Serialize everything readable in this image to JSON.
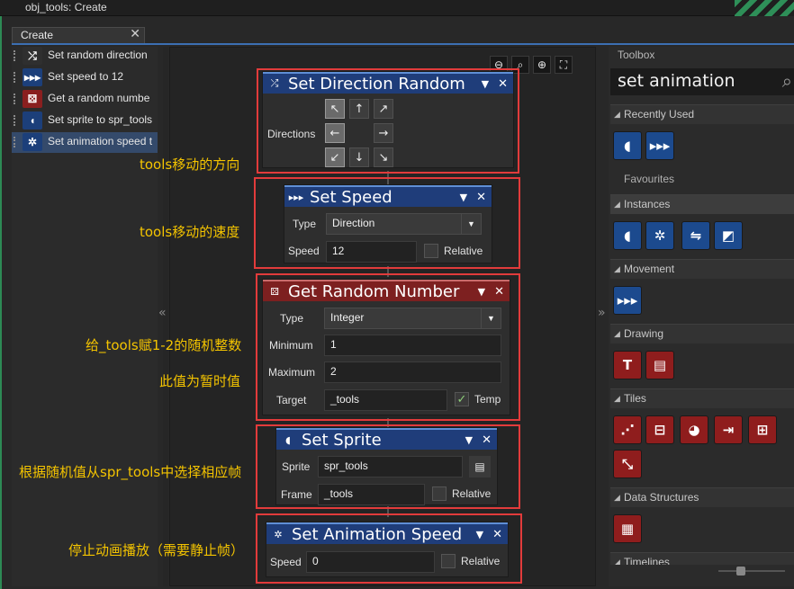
{
  "window": {
    "title": "obj_tools: Create"
  },
  "tab": {
    "label": "Create",
    "close": "✕"
  },
  "action_list": [
    {
      "label": "Set random direction",
      "icon": "random-direction-icon",
      "color": "#2f2f2f"
    },
    {
      "label": "Set speed to 12",
      "icon": "speed-icon",
      "color": "#1c3f7a"
    },
    {
      "label": "Get a random numbe",
      "icon": "dice-icon",
      "color": "#8a1f1f"
    },
    {
      "label": "Set sprite to spr_tools",
      "icon": "pacman-icon",
      "color": "#1c3f7a"
    },
    {
      "label": "Set animation speed t",
      "icon": "running-figure-icon",
      "color": "#1c3f7a"
    }
  ],
  "blocks": {
    "direction": {
      "title": "Set Direction Random",
      "label": "Directions",
      "active": [
        "nw",
        "w",
        "sw"
      ]
    },
    "speed": {
      "title": "Set Speed",
      "type_label": "Type",
      "type_value": "Direction",
      "speed_label": "Speed",
      "speed_value": "12",
      "relative": "Relative"
    },
    "random": {
      "title": "Get Random Number",
      "type_label": "Type",
      "type_value": "Integer",
      "min_label": "Minimum",
      "min_value": "1",
      "max_label": "Maximum",
      "max_value": "2",
      "target_label": "Target",
      "target_value": "_tools",
      "temp": "Temp"
    },
    "sprite": {
      "title": "Set Sprite",
      "sprite_label": "Sprite",
      "sprite_value": "spr_tools",
      "frame_label": "Frame",
      "frame_value": "_tools",
      "relative": "Relative"
    },
    "anim": {
      "title": "Set Animation Speed",
      "speed_label": "Speed",
      "speed_value": "0",
      "relative": "Relative"
    }
  },
  "annotations": [
    "tools移动的方向",
    "tools移动的速度",
    "给_tools赋1-2的随机整数",
    "此值为暂时值",
    "根据随机值从spr_tools中选择相应帧",
    "停止动画播放（需要静止帧）"
  ],
  "toolbox": {
    "title": "Toolbox",
    "search": "set animation",
    "sections": {
      "recently_used": "Recently Used",
      "favourites": "Favourites",
      "instances": "Instances",
      "movement": "Movement",
      "drawing": "Drawing",
      "tiles": "Tiles",
      "data_structures": "Data Structures",
      "timelines": "Timelines"
    }
  },
  "colors": {
    "accent": "#3c6fb2",
    "annotation": "#f4c400",
    "highlight_box": "#e23b3b",
    "block_blue": "#1f3d7a",
    "block_red": "#7d2020"
  }
}
